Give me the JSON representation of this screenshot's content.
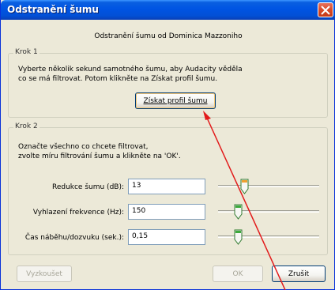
{
  "window": {
    "title": "Odstranění šumu",
    "subtitle": "Odstranění šumu od Dominica Mazzoniho"
  },
  "step1": {
    "label": "Krok 1",
    "text_line1": "Vyberte několik sekund samotného šumu, aby Audacity věděla",
    "text_line2": "co se má filtrovat. Potom klikněte na Získat profil šumu.",
    "button_label": "Získat profil šumu"
  },
  "step2": {
    "label": "Krok 2",
    "text_line1": "Označte všechno co chcete filtrovat,",
    "text_line2": "zvolte míru filtrování šumu a klikněte na 'OK'.",
    "rows": [
      {
        "label": "Redukce šumu (dB):",
        "value": "13",
        "slider_position": 0.24,
        "thumb_color": "#f0a030"
      },
      {
        "label": "Vyhlazení frekvence (Hz):",
        "value": "150",
        "slider_position": 0.17,
        "thumb_color": "#3caa3c"
      },
      {
        "label": "Čas náběhu/dozvuku (sek.):",
        "value": "0,15",
        "slider_position": 0.17,
        "thumb_color": "#3caa3c"
      }
    ]
  },
  "footer": {
    "preview_label": "Vyzkoušet",
    "ok_label": "OK",
    "cancel_label": "Zrušit"
  },
  "colors": {
    "annotation_arrow": "#e21a1a",
    "titlebar": "#0054e3"
  }
}
